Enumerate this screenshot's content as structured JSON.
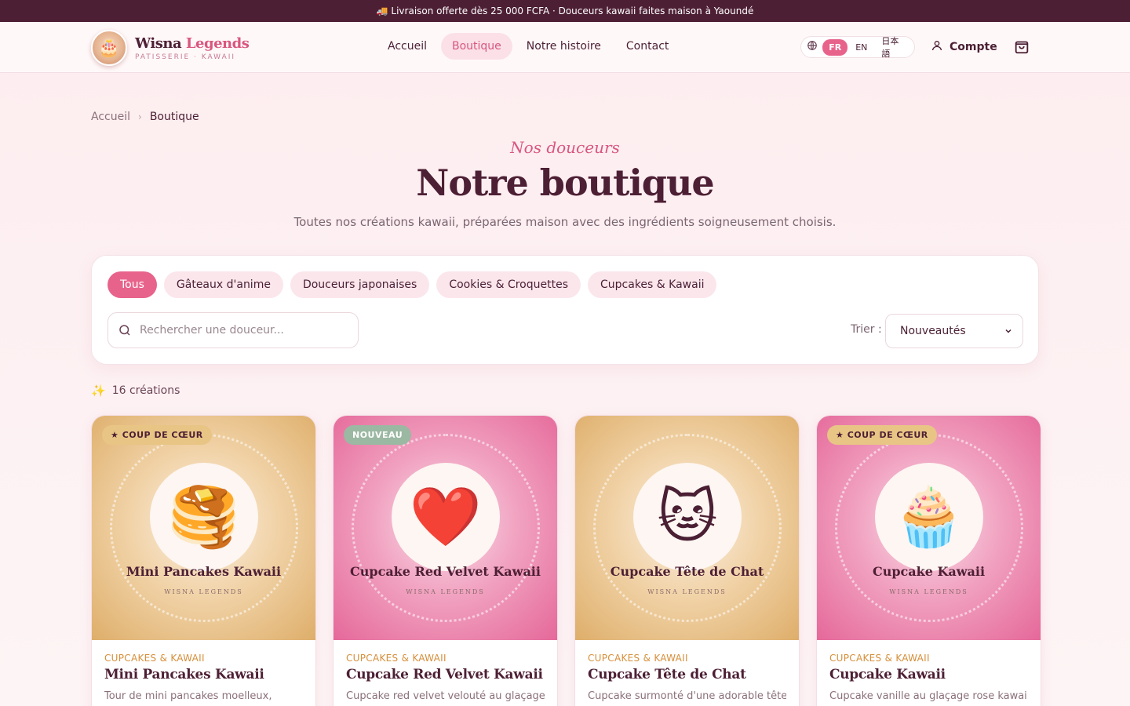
{
  "announcement": "🚚 Livraison offerte dès 25 000 FCFA · Douceurs kawaii faites maison à Yaoundé",
  "brand": {
    "name_part1": "Wisna ",
    "name_part2": "Legends",
    "tagline": "PATISSERIE · KAWAII",
    "logo_icon": "cake-logo"
  },
  "nav": [
    {
      "label": "Accueil"
    },
    {
      "label": "Boutique",
      "active": true
    },
    {
      "label": "Notre histoire"
    },
    {
      "label": "Contact"
    }
  ],
  "languages": [
    {
      "label": "FR",
      "active": true
    },
    {
      "label": "EN"
    },
    {
      "label": "日本語"
    }
  ],
  "account_label": "Compte",
  "breadcrumb": {
    "home": "Accueil",
    "separator": "›",
    "current": "Boutique"
  },
  "hero": {
    "eyebrow": "Nos douceurs",
    "title": "Notre boutique",
    "subtitle": "Toutes nos créations kawaii, préparées maison avec des ingrédients soigneusement choisis."
  },
  "filters": {
    "categories": [
      {
        "label": "Tous",
        "active": true
      },
      {
        "label": "Gâteaux d'anime"
      },
      {
        "label": "Douceurs japonaises"
      },
      {
        "label": "Cookies & Croquettes"
      },
      {
        "label": "Cupcakes & Kawaii"
      }
    ],
    "search_placeholder": "Rechercher une douceur...",
    "sort_label": "Trier :",
    "sort_value": "Nouveautés"
  },
  "result_count": "16 créations",
  "products": [
    {
      "badge": "★ COUP DE CŒUR",
      "badge_type": "fav",
      "theme": "gold",
      "emoji": "🥞",
      "media_title": "Mini Pancakes Kawaii",
      "brand": "WISNA LEGENDS",
      "category": "CUPCAKES & KAWAII",
      "title": "Mini Pancakes Kawaii",
      "description": "Tour de mini pancakes moelleux,"
    },
    {
      "badge": "NOUVEAU",
      "badge_type": "new",
      "theme": "pink",
      "emoji": "❤️",
      "media_title": "Cupcake Red Velvet Kawaii",
      "brand": "WISNA LEGENDS",
      "category": "CUPCAKES & KAWAII",
      "title": "Cupcake Red Velvet Kawaii",
      "description": "Cupcake red velvet velouté au glaçage"
    },
    {
      "badge": "",
      "badge_type": "none",
      "theme": "gold",
      "emoji": "🐱",
      "media_title": "Cupcake Tête de Chat",
      "brand": "WISNA LEGENDS",
      "category": "CUPCAKES & KAWAII",
      "title": "Cupcake Tête de Chat",
      "description": "Cupcake surmonté d'une adorable tête"
    },
    {
      "badge": "★ COUP DE CŒUR",
      "badge_type": "fav",
      "theme": "pink",
      "emoji": "🧁",
      "media_title": "Cupcake Kawaii",
      "brand": "WISNA LEGENDS",
      "category": "CUPCAKES & KAWAII",
      "title": "Cupcake Kawaii",
      "description": "Cupcake vanille au glaçage rose kawaii"
    }
  ],
  "colors": {
    "accent": "#e8638c",
    "brand_dark": "#4d1f34",
    "category": "#d68f3a"
  }
}
